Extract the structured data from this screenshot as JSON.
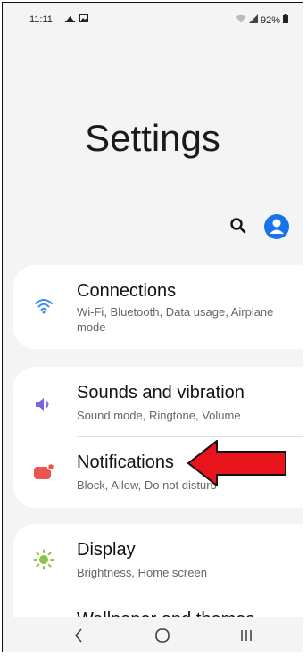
{
  "status_bar": {
    "time": "11:11",
    "battery": "92%",
    "icons_left": [
      "alarm-icon",
      "gallery-icon"
    ],
    "icons_right": [
      "wifi-icon",
      "signal-icon",
      "battery-icon"
    ]
  },
  "header": {
    "title": "Settings"
  },
  "toolbar": {
    "search_icon": "search-icon",
    "profile_icon": "profile-icon",
    "accent_color": "#1a73e8"
  },
  "settings": {
    "connections": {
      "title": "Connections",
      "subtitle": "Wi-Fi, Bluetooth, Data usage, Airplane mode",
      "icon": "wifi-icon",
      "color": "#3d8cf0"
    },
    "sounds": {
      "title": "Sounds and vibration",
      "subtitle": "Sound mode, Ringtone, Volume",
      "icon": "volume-icon",
      "color": "#7a63e8"
    },
    "notifications": {
      "title": "Notifications",
      "subtitle": "Block, Allow, Do not disturb",
      "icon": "notification-icon",
      "color": "#ef5350"
    },
    "display": {
      "title": "Display",
      "subtitle": "Brightness, Home screen",
      "icon": "sun-icon",
      "color": "#8bc34a"
    },
    "wallpaper": {
      "title": "Wallpaper and themes",
      "icon": "wallpaper-icon"
    }
  },
  "annotation": {
    "icon": "red-arrow-icon",
    "color": "#e8141b"
  },
  "nav_bar": {
    "back_icon": "back-icon",
    "home_icon": "home-icon",
    "recents_icon": "recents-icon"
  }
}
